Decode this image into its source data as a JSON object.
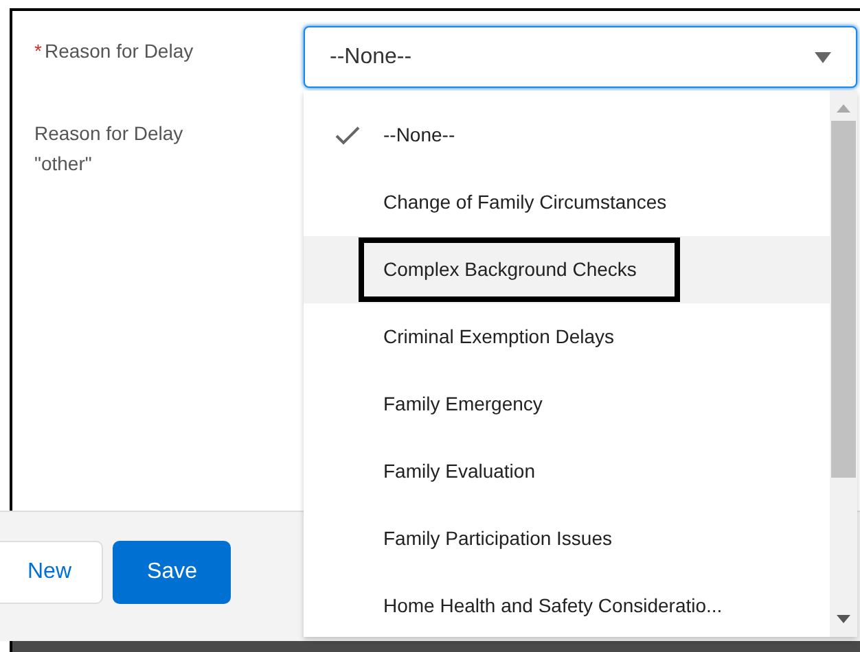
{
  "required_mark": "*",
  "fields": [
    {
      "label": "Reason for Delay",
      "required": true
    },
    {
      "label": "Reason for Delay \"other\"",
      "required": false
    }
  ],
  "select": {
    "value": "--None--",
    "expanded": true
  },
  "options": [
    {
      "label": "--None--",
      "selected": true,
      "highlighted": false
    },
    {
      "label": "Change of Family Circumstances",
      "selected": false,
      "highlighted": false
    },
    {
      "label": "Complex Background Checks",
      "selected": false,
      "highlighted": true
    },
    {
      "label": "Criminal Exemption Delays",
      "selected": false,
      "highlighted": false
    },
    {
      "label": "Family Emergency",
      "selected": false,
      "highlighted": false
    },
    {
      "label": "Family Evaluation",
      "selected": false,
      "highlighted": false
    },
    {
      "label": "Family Participation Issues",
      "selected": false,
      "highlighted": false
    },
    {
      "label": "Home Health and Safety Consideratio...",
      "selected": false,
      "highlighted": false
    }
  ],
  "buttons": [
    {
      "label": "New",
      "kind": "secondary"
    },
    {
      "label": "Save",
      "kind": "primary"
    }
  ]
}
